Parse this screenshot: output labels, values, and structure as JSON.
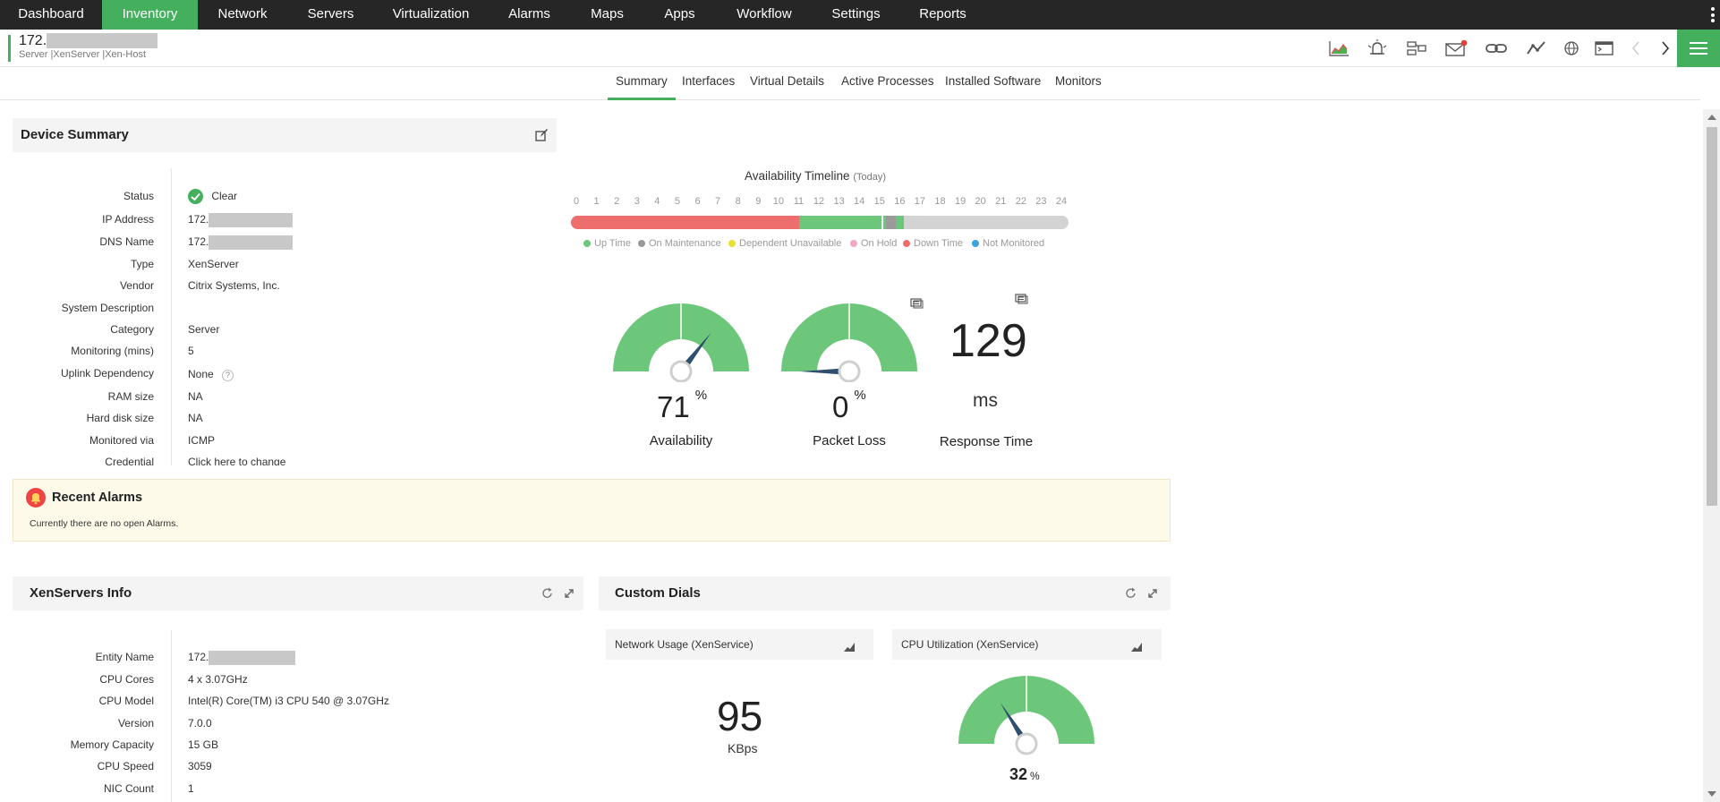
{
  "nav": {
    "items": [
      {
        "label": "Dashboard"
      },
      {
        "label": "Inventory"
      },
      {
        "label": "Network"
      },
      {
        "label": "Servers"
      },
      {
        "label": "Virtualization"
      },
      {
        "label": "Alarms"
      },
      {
        "label": "Maps"
      },
      {
        "label": "Apps"
      },
      {
        "label": "Workflow"
      },
      {
        "label": "Settings"
      },
      {
        "label": "Reports"
      }
    ],
    "active": "Inventory",
    "accent_color": "#44b05e",
    "background": "#262626"
  },
  "device": {
    "ip_visible": "172.",
    "type_path": "Server |XenServer |Xen-Host"
  },
  "toolbar_icons": [
    "graph-icon",
    "alarm-bell-icon",
    "config-icon",
    "mail-icon",
    "link-icon",
    "trend-icon",
    "globe-icon",
    "terminal-icon",
    "prev-chevron-icon",
    "next-chevron-icon",
    "hamburger-menu-icon"
  ],
  "tabs": [
    {
      "label": "Summary"
    },
    {
      "label": "Interfaces"
    },
    {
      "label": "Virtual Details"
    },
    {
      "label": "Active Processes"
    },
    {
      "label": "Installed Software"
    },
    {
      "label": "Monitors"
    }
  ],
  "active_tab": "Summary",
  "device_summary": {
    "title": "Device Summary",
    "labels": {
      "status": "Status",
      "ip": "IP Address",
      "dns": "DNS Name",
      "type": "Type",
      "vendor": "Vendor",
      "sysdesc": "System Description",
      "category": "Category",
      "monitoring": "Monitoring (mins)",
      "uplink": "Uplink Dependency",
      "ram": "RAM size",
      "hdd": "Hard disk size",
      "via": "Monitored via",
      "cred": "Credential"
    },
    "values": {
      "status": "Clear",
      "ip": "172.",
      "dns": "172.",
      "type": "XenServer",
      "vendor": "Citrix Systems, Inc.",
      "category": "Server",
      "monitoring": "5",
      "uplink": "None",
      "ram": "NA",
      "hdd": "NA",
      "via": "ICMP",
      "cred": "Click here to change"
    }
  },
  "timeline": {
    "title": "Availability Timeline",
    "period": "(Today)",
    "hours": [
      "0",
      "1",
      "2",
      "3",
      "4",
      "5",
      "6",
      "7",
      "8",
      "9",
      "10",
      "11",
      "12",
      "13",
      "14",
      "15",
      "16",
      "17",
      "18",
      "19",
      "20",
      "21",
      "22",
      "23",
      "24"
    ],
    "legend": [
      {
        "label": "Up Time",
        "color": "#6cc77a"
      },
      {
        "label": "On Maintenance",
        "color": "#9a9a9a"
      },
      {
        "label": "Dependent Unavailable",
        "color": "#e8e02f"
      },
      {
        "label": "On Hold",
        "color": "#f4a7c0"
      },
      {
        "label": "Down Time",
        "color": "#ee6e6e"
      },
      {
        "label": "Not Monitored",
        "color": "#3ba2e0"
      }
    ]
  },
  "availability": {
    "value": "71",
    "unit": "%",
    "label": "Availability",
    "fraction": 0.71
  },
  "packet_loss": {
    "value": "0",
    "unit": "%",
    "label": "Packet Loss",
    "fraction": 0.0
  },
  "response_time": {
    "value": "129",
    "unit": "ms",
    "label": "Response Time"
  },
  "recent_alarms": {
    "title": "Recent Alarms",
    "message": "Currently there are no open Alarms."
  },
  "xenservers_info": {
    "title": "XenServers Info",
    "labels": {
      "entity": "Entity Name",
      "cores": "CPU Cores",
      "model": "CPU Model",
      "version": "Version",
      "memory": "Memory Capacity",
      "speed": "CPU Speed",
      "nic": "NIC Count"
    },
    "values": {
      "entity": "172.",
      "cores": "4 x 3.07GHz",
      "model": "Intel(R) Core(TM) i3 CPU 540 @ 3.07GHz",
      "version": "7.0.0",
      "memory": "15 GB",
      "speed": "3059",
      "nic": "1"
    }
  },
  "custom_dials": {
    "title": "Custom Dials",
    "network_usage": {
      "title": "Network Usage (XenService)",
      "value": "95",
      "unit": "KBps"
    },
    "cpu_utilization": {
      "title": "CPU Utilization (XenService)",
      "value": "32",
      "unit": "%",
      "fraction": 0.32
    }
  }
}
